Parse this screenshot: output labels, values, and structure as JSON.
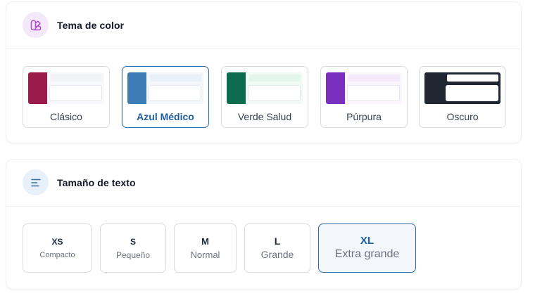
{
  "theme_section": {
    "title": "Tema de color",
    "icon": "palette-icon",
    "icon_bg": "#f4e8fb",
    "icon_color": "#b04fd4",
    "options": [
      {
        "label": "Clásico",
        "accent": "#9b1b4a",
        "tint": "#f7f8fc",
        "line": "#f1f3f8",
        "box": "#ffffff",
        "selected": false
      },
      {
        "label": "Azul Médico",
        "accent": "#3d7cb5",
        "tint": "#f3f7fc",
        "line": "#e9f0f8",
        "box": "#ffffff",
        "selected": true
      },
      {
        "label": "Verde Salud",
        "accent": "#0f6b4d",
        "tint": "#f0fbf6",
        "line": "#e3f5ec",
        "box": "#ffffff",
        "selected": false
      },
      {
        "label": "Púrpura",
        "accent": "#7b2fbf",
        "tint": "#fbf6fd",
        "line": "#f4eafb",
        "box": "#ffffff",
        "selected": false
      },
      {
        "label": "Oscuro",
        "accent": "#1f2733",
        "tint": "#1f2733",
        "line": "#ffffff",
        "box": "#ffffff",
        "selected": false
      }
    ]
  },
  "text_section": {
    "title": "Tamaño de texto",
    "icon": "text-align-icon",
    "icon_bg": "#e8f0fa",
    "icon_color": "#3a6fa6",
    "options": [
      {
        "code": "XS",
        "name": "Compacto",
        "selected": false
      },
      {
        "code": "S",
        "name": "Pequeño",
        "selected": false
      },
      {
        "code": "M",
        "name": "Normal",
        "selected": false
      },
      {
        "code": "L",
        "name": "Grande",
        "selected": false
      },
      {
        "code": "XL",
        "name": "Extra grande",
        "selected": true
      }
    ]
  }
}
